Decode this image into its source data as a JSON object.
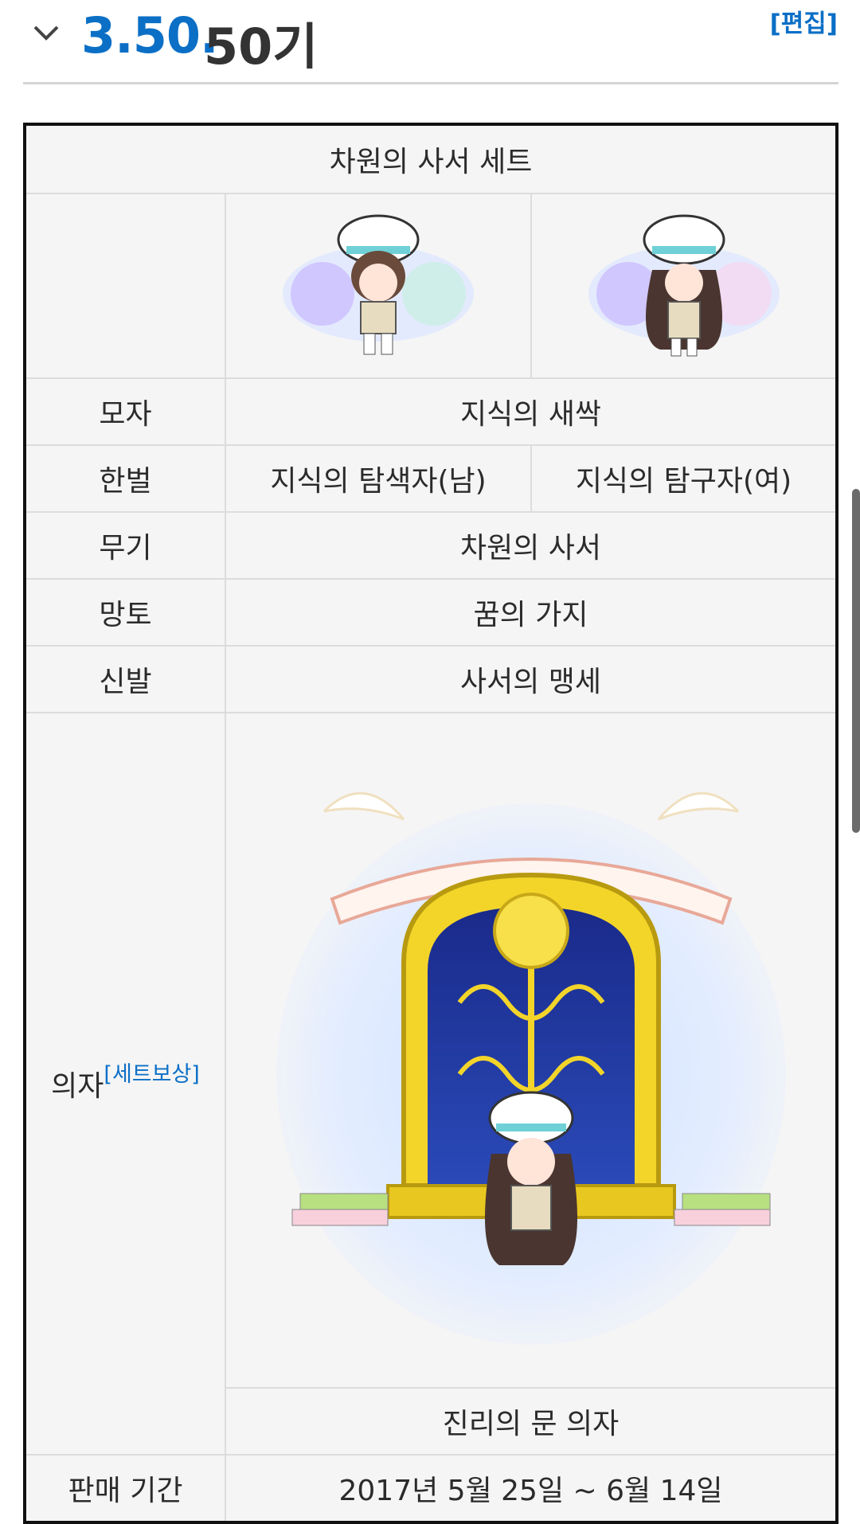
{
  "heading": {
    "number": "3.50.",
    "title": "50기",
    "edit_link": "[편집]",
    "collapse_icon": "chevron-down-icon"
  },
  "set_table": {
    "title": "차원의 사서 세트",
    "rows": [
      {
        "label": "모자",
        "value": "지식의 새싹"
      },
      {
        "label": "한벌",
        "value_male": "지식의 탐색자(남)",
        "value_female": "지식의 탐구자(여)"
      },
      {
        "label": "무기",
        "value": "차원의 사서"
      },
      {
        "label": "망토",
        "value": "꿈의 가지"
      },
      {
        "label": "신발",
        "value": "사서의 맹세"
      }
    ],
    "chair": {
      "label": "의자",
      "label_link": "[세트보상]",
      "name": "진리의 문 의자"
    },
    "period": {
      "label": "판매 기간",
      "value": "2017년 5월 25일 ~ 6월 14일"
    }
  },
  "colors": {
    "accent": "#0b6fc6",
    "table_border": "#111111",
    "cell_bg": "#f5f5f5"
  }
}
